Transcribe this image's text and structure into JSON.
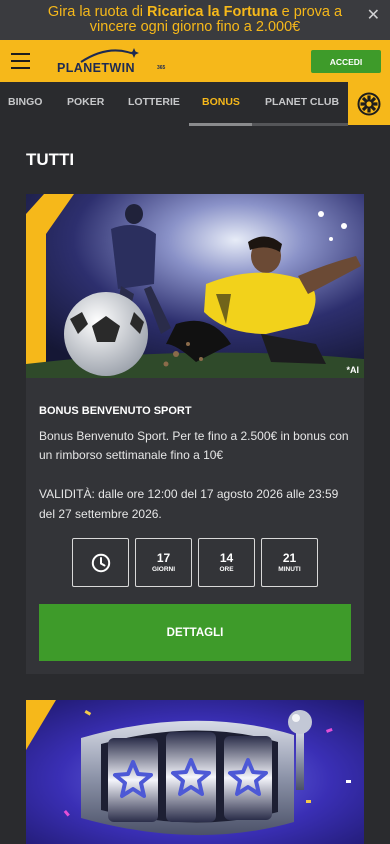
{
  "promo_banner": {
    "text_part1": "Gira la ruota di ",
    "text_bold": "Ricarica la Fortuna",
    "text_part2": " e prova a vincere ogni giorno fino a 2.000€",
    "close_symbol": "✕"
  },
  "header": {
    "logo_text": "PLANETWIN",
    "logo_sup": "365",
    "login_label": "ACCEDI"
  },
  "nav": {
    "items": [
      {
        "label": "BINGO"
      },
      {
        "label": "POKER"
      },
      {
        "label": "LOTTERIE"
      },
      {
        "label": "BONUS"
      },
      {
        "label": "PLANET CLUB"
      }
    ],
    "active": "BONUS"
  },
  "section_title": "TUTTI",
  "bonus_card": {
    "image_tag": "*AI",
    "title": "BONUS BENVENUTO SPORT",
    "description": "Bonus Benvenuto Sport. Per te fino a 2.500€ in bonus con un rimborso settimanale fino a 10€",
    "validity": "VALIDITÀ: dalle ore 12:00 del 17 agosto 2026 alle 23:59 del 27 settembre 2026.",
    "countdown": [
      {
        "value": "17",
        "label": "GIORNI"
      },
      {
        "value": "14",
        "label": "ORE"
      },
      {
        "value": "21",
        "label": "MINUTI"
      }
    ],
    "details_label": "DETTAGLI"
  },
  "colors": {
    "accent_yellow": "#f6b81a",
    "cta_green": "#3e9b2a",
    "background": "#2a2b2e",
    "card": "#333438"
  },
  "icons": {
    "menu": "hamburger-icon",
    "wheel": "fortune-wheel-icon",
    "clock": "clock-icon",
    "close": "close-icon"
  }
}
